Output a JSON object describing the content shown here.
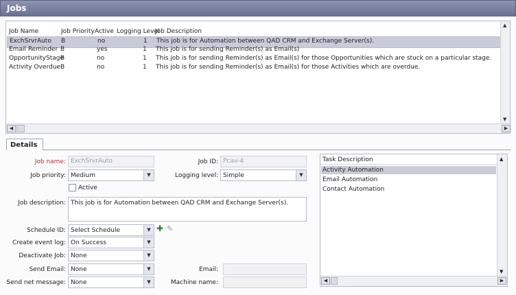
{
  "window": {
    "title": "Jobs"
  },
  "grid": {
    "columns": [
      "Job Name",
      "Job Priority",
      "Active",
      "Logging Level",
      "Job Description"
    ],
    "rows": [
      {
        "name": "ExchSrvrAuto",
        "priority": "B",
        "active": "no",
        "logging": "1",
        "description": "This job is for Automation between QAD CRM and Exchange Server(s)."
      },
      {
        "name": "Email Reminder",
        "priority": "B",
        "active": "yes",
        "logging": "1",
        "description": "This job is for sending Reminder(s) as Email(s)"
      },
      {
        "name": "OpportunityStage",
        "priority": "B",
        "active": "no",
        "logging": "1",
        "description": "This job is for sending Reminder(s) as Email(s) for those Opportunities which are stuck on a particular stage."
      },
      {
        "name": "Activity Overdue",
        "priority": "B",
        "active": "no",
        "logging": "1",
        "description": "This job is for sending Reminder(s) as Email(s) for those Activities which are overdue."
      }
    ]
  },
  "tabs": {
    "details": "Details"
  },
  "form": {
    "job_name_label": "Job name:",
    "job_name_value": "ExchSrvrAuto",
    "job_id_label": "Job ID:",
    "job_id_value": "Pcav-4",
    "job_priority_label": "Job priority:",
    "job_priority_value": "Medium",
    "logging_level_label": "Logging level:",
    "logging_level_value": "Simple",
    "active_label": "Active",
    "job_description_label": "Job description:",
    "job_description_value": "This job is for Automation between QAD CRM and Exchange Server(s).",
    "schedule_id_label": "Schedule ID:",
    "schedule_id_value": "Select Schedule",
    "create_event_log_label": "Create event log:",
    "create_event_log_value": "On Success",
    "deactivate_job_label": "Deactivate Job:",
    "deactivate_job_value": "None",
    "send_email_label": "Send Email:",
    "send_email_value": "None",
    "send_net_message_label": "Send net message:",
    "send_net_message_value": "None",
    "email_label": "Email:",
    "machine_name_label": "Machine name:"
  },
  "task_panel": {
    "header": "Task Description",
    "items": [
      "Activity Automation",
      "Email Automation",
      "Contact Automation"
    ]
  }
}
